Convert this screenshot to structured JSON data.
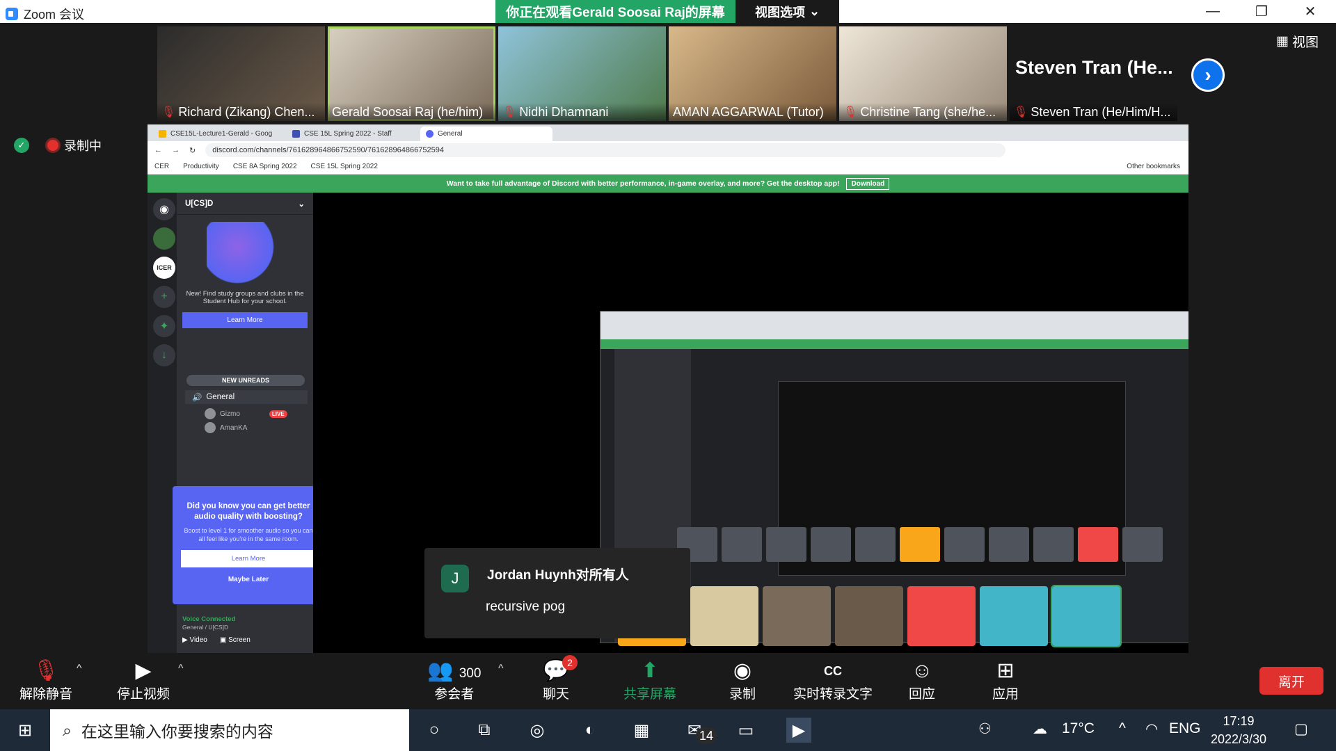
{
  "window": {
    "title": "Zoom 会议",
    "share_banner": "你正在观看Gerald Soosai Raj的屏幕",
    "view_options": "视图选项",
    "controls": [
      "—",
      "❐",
      "✕"
    ]
  },
  "participants": [
    {
      "name": "Richard (Zikang) Chen...",
      "muted": true
    },
    {
      "name": "Gerald Soosai Raj (he/him)",
      "muted": false,
      "active": true
    },
    {
      "name": "Nidhi Dhamnani",
      "muted": true
    },
    {
      "name": "AMAN AGGARWAL (Tutor)",
      "muted": false
    },
    {
      "name": "Christine Tang (she/he...",
      "muted": true
    },
    {
      "name": "Steven Tran (He/Him/H...",
      "muted": true,
      "header": "Steven Tran (He..."
    }
  ],
  "view_button": "视图",
  "recording": "录制中",
  "browser": {
    "tabs": [
      "CSE15L-Lecture1-Gerald - Goog",
      "CSE 15L Spring 2022 - Staff",
      "General"
    ],
    "url": "discord.com/channels/761628964866752590/761628964866752594",
    "bookmarks": [
      "CER",
      "Productivity",
      "CSE 8A Spring 2022",
      "CSE 15L Spring 2022"
    ],
    "other_bookmarks": "Other bookmarks"
  },
  "discord": {
    "banner": "Want to take full advantage of Discord with better performance, in-game overlay, and more? Get the desktop app!",
    "download": "Download",
    "server": "U[CS]D",
    "promo_text": "New! Find study groups and clubs in the Student Hub for your school.",
    "learn_more": "Learn More",
    "new_unreads": "NEW UNREADS",
    "channel": "General",
    "members": [
      {
        "name": "Gizmo",
        "live": "LIVE"
      },
      {
        "name": "AmanKA"
      }
    ],
    "boost_title": "Did you know you can get better audio quality with boosting?",
    "boost_text": "Boost to level 1 for smoother audio so you can all feel like you're in the same room.",
    "boost_learn": "Learn More",
    "boost_later": "Maybe Later",
    "voice_connected": "Voice Connected",
    "voice_channel": "General / U[CS]D",
    "video": "Video",
    "screen": "Screen",
    "live_label": "LIVE"
  },
  "chat_popup": {
    "avatar": "J",
    "sender": "Jordan Huynh对所有人",
    "message": "recursive pog"
  },
  "toolbar": {
    "unmute": "解除静音",
    "stop_video": "停止视频",
    "participants": "参会者",
    "participant_count": "300",
    "chat": "聊天",
    "chat_badge": "2",
    "share": "共享屏幕",
    "record": "录制",
    "captions": "实时转录文字",
    "reactions": "回应",
    "apps": "应用",
    "leave": "离开"
  },
  "taskbar": {
    "search_placeholder": "在这里输入你要搜索的内容",
    "weather": "17°C",
    "lang": "ENG",
    "time": "17:19",
    "date": "2022/3/30",
    "mail_badge": "14"
  }
}
